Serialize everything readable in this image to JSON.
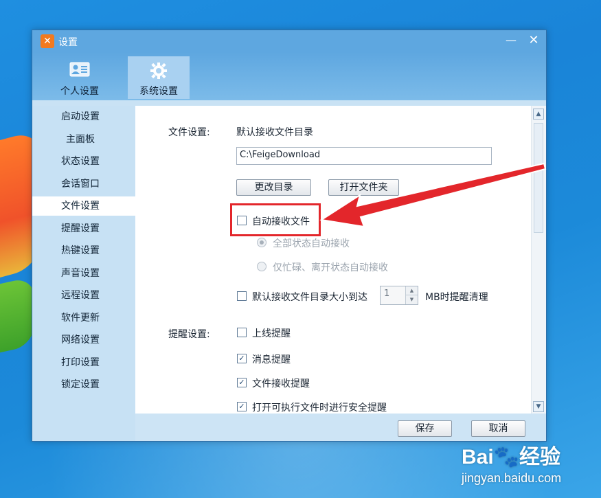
{
  "window": {
    "title": "设置",
    "logo": "飞秋 logo"
  },
  "top_tabs": [
    {
      "label": "个人设置",
      "icon": "contact-card-icon"
    },
    {
      "label": "系统设置",
      "icon": "gear-icon"
    }
  ],
  "sidebar": {
    "items": [
      {
        "label": "启动设置"
      },
      {
        "label": "主面板"
      },
      {
        "label": "状态设置"
      },
      {
        "label": "会话窗口"
      },
      {
        "label": "文件设置"
      },
      {
        "label": "提醒设置"
      },
      {
        "label": "热键设置"
      },
      {
        "label": "声音设置"
      },
      {
        "label": "远程设置"
      },
      {
        "label": "软件更新"
      },
      {
        "label": "网络设置"
      },
      {
        "label": "打印设置"
      },
      {
        "label": "锁定设置"
      }
    ],
    "active_index": 4
  },
  "file_settings": {
    "section_label": "文件设置:",
    "default_dir_label": "默认接收文件目录",
    "default_dir_value": "C:\\FeigeDownload",
    "change_dir_button": "更改目录",
    "open_folder_button": "打开文件夹",
    "auto_receive_label": "自动接收文件",
    "auto_receive_checked": false,
    "radio_all_status": "全部状态自动接收",
    "radio_busy_away": "仅忙碌、离开状态自动接收",
    "size_limit_label_before": "默认接收文件目录大小到达",
    "size_limit_value": "1",
    "size_limit_label_after": "MB时提醒清理",
    "size_limit_checked": false
  },
  "reminder_settings": {
    "section_label": "提醒设置:",
    "items": [
      {
        "label": "上线提醒",
        "checked": false
      },
      {
        "label": "消息提醒",
        "checked": true
      },
      {
        "label": "文件接收提醒",
        "checked": true
      },
      {
        "label": "打开可执行文件时进行安全提醒",
        "checked": true
      }
    ]
  },
  "footer": {
    "save_button": "保存",
    "cancel_button": "取消"
  },
  "watermark": {
    "logo": "Bai🐾经验",
    "url": "jingyan.baidu.com"
  },
  "colors": {
    "annotation_red": "#e3262b",
    "titlebar": "#5ea7e0",
    "sidebar": "#c7e1f4"
  }
}
